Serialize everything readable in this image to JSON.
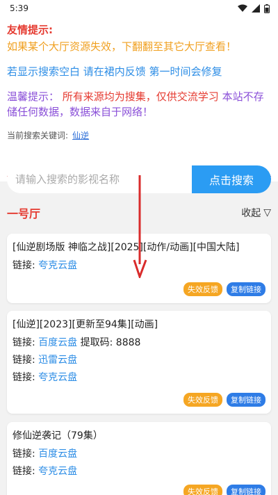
{
  "status": {
    "time": "5:39"
  },
  "notice": {
    "title": "友情提示:",
    "line1": "如果某个大厅资源失效，下翻翻至其它大厅查看！",
    "line2": "若显示搜索空白 请在裙内反馈 第一时间会修复",
    "warm_prefix": "温馨提示：",
    "warm_red": "所有来源均为搜集，仅供交流学习",
    "warm_purple": "本站不存储任何数据，数据来自于网络！",
    "keyword_label": "当前搜索关键词:",
    "keyword": "仙逆"
  },
  "search": {
    "placeholder": "请输入搜索的影视名称",
    "button": "点击搜索"
  },
  "hall": {
    "title": "一号厅",
    "collapse_label": "收起",
    "collapse_symbol": "▽"
  },
  "link_label": "链接:",
  "feedback_label": "失效反馈",
  "copy_label": "复制链接",
  "cards": [
    {
      "title": "[仙逆剧场版 神临之战][2025][动作/动画][中国大陆]",
      "links": [
        {
          "provider": "夸克云盘",
          "extra": ""
        }
      ]
    },
    {
      "title": "[仙逆][2023][更新至94集][动画]",
      "links": [
        {
          "provider": "百度云盘",
          "extra": "提取码: 8888"
        },
        {
          "provider": "迅雷云盘",
          "extra": ""
        },
        {
          "provider": "夸克云盘",
          "extra": ""
        }
      ]
    },
    {
      "title": "修仙逆袭记（79集）",
      "links": [
        {
          "provider": "百度云盘",
          "extra": ""
        },
        {
          "provider": "夸克云盘",
          "extra": ""
        }
      ]
    }
  ],
  "colors": {
    "accent": "#2b9cf3",
    "warning": "#e53a30",
    "feedback": "#f5a623"
  }
}
